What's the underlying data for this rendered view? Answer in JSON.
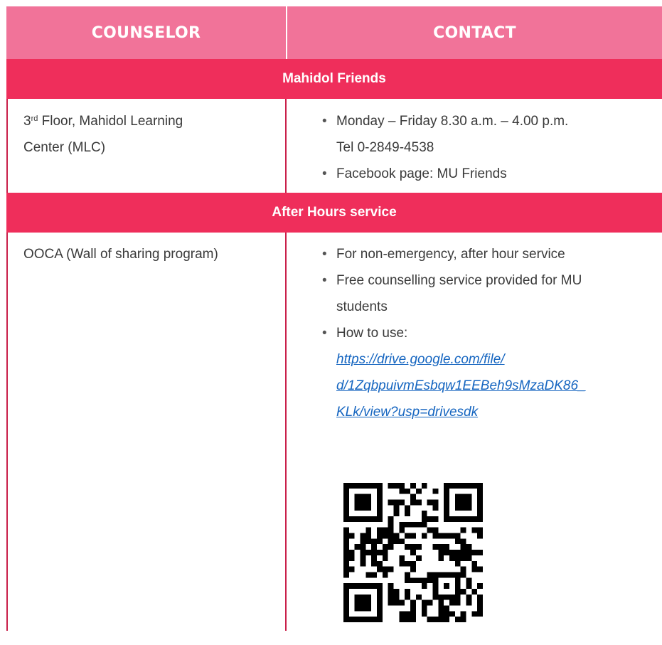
{
  "header": {
    "counselor": "COUNSELOR",
    "contact": "CONTACT"
  },
  "sections": [
    {
      "title": "Mahidol Friends",
      "location": {
        "floor_num": "3",
        "floor_sup": "rd",
        "rest_line1": " Floor, Mahidol Learning",
        "line2": "Center (MLC)"
      },
      "bullets": [
        {
          "line1": "Monday – Friday 8.30 a.m. – 4.00 p.m.",
          "line2": "Tel 0-2849-4538"
        },
        {
          "line1": "Facebook page: MU Friends"
        }
      ]
    },
    {
      "title": "After Hours service",
      "location": {
        "line1": "OOCA (Wall of sharing program)"
      },
      "bullets": [
        {
          "line1": "For non-emergency, after hour service"
        },
        {
          "line1": "Free counselling service provided for MU",
          "line2": "students"
        },
        {
          "line1": "How to use:"
        }
      ],
      "link_lines": [
        "https://drive.google.com/file/",
        "d/1ZqbpuivmEsbqw1EEBeh9sMzaDK86_",
        "KLk/view?usp=drivesdk"
      ],
      "qr_icon": "qr-code-icon"
    }
  ]
}
